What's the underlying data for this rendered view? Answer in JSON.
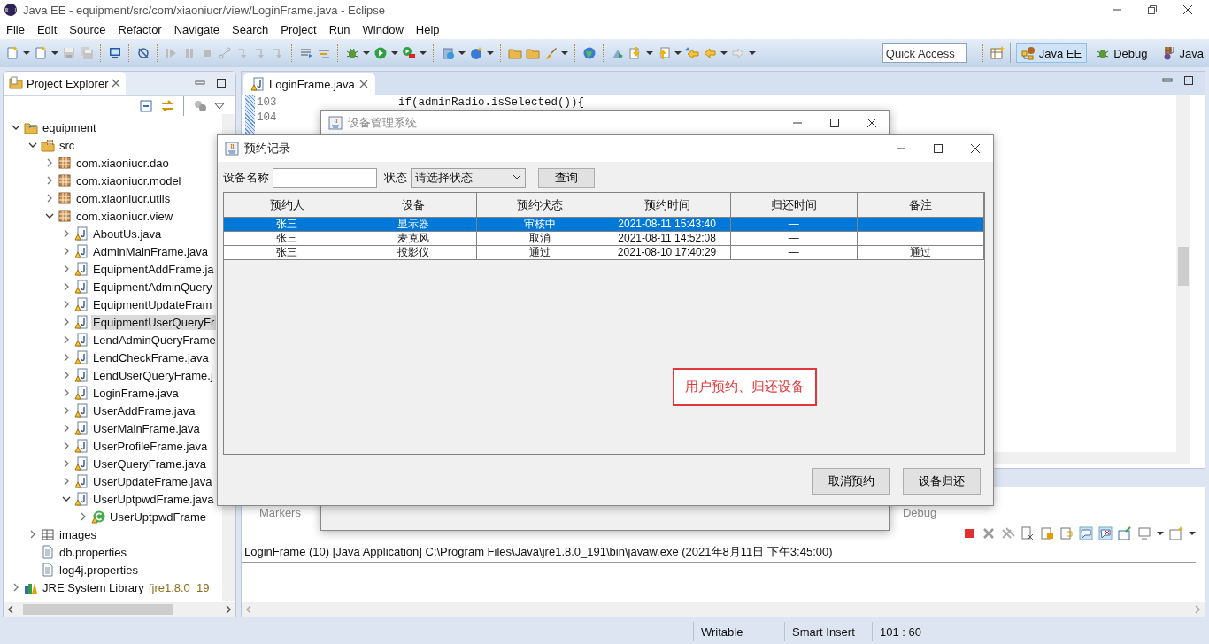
{
  "window": {
    "title": "Java EE - equipment/src/com/xiaoniucr/view/LoginFrame.java - Eclipse"
  },
  "menu": [
    "File",
    "Edit",
    "Source",
    "Refactor",
    "Navigate",
    "Search",
    "Project",
    "Run",
    "Window",
    "Help"
  ],
  "quick_access": {
    "placeholder": "Quick Access"
  },
  "perspectives": [
    {
      "label": "Java EE",
      "kind": "javaee",
      "selected": true
    },
    {
      "label": "Debug",
      "kind": "debug",
      "selected": false
    },
    {
      "label": "Java",
      "kind": "java",
      "selected": false
    }
  ],
  "project_explorer": {
    "title": "Project Explorer",
    "tree": [
      {
        "label": "equipment",
        "kind": "project",
        "expanded": true,
        "selected": false,
        "children": [
          {
            "label": "src",
            "kind": "source",
            "expanded": true,
            "selected": false,
            "children": [
              {
                "label": "com.xiaoniucr.dao",
                "kind": "package",
                "expanded": false,
                "selected": false
              },
              {
                "label": "com.xiaoniucr.model",
                "kind": "package",
                "expanded": false,
                "selected": false
              },
              {
                "label": "com.xiaoniucr.utils",
                "kind": "package",
                "expanded": false,
                "selected": false
              },
              {
                "label": "com.xiaoniucr.view",
                "kind": "package",
                "expanded": true,
                "selected": false,
                "children": [
                  {
                    "label": "AboutUs.java",
                    "kind": "java",
                    "expanded": false,
                    "selected": false
                  },
                  {
                    "label": "AdminMainFrame.java",
                    "kind": "java",
                    "expanded": false,
                    "selected": false
                  },
                  {
                    "label": "EquipmentAddFrame.ja",
                    "kind": "java",
                    "expanded": false,
                    "selected": false
                  },
                  {
                    "label": "EquipmentAdminQuery",
                    "kind": "java",
                    "expanded": false,
                    "selected": false
                  },
                  {
                    "label": "EquipmentUpdateFram",
                    "kind": "java",
                    "expanded": false,
                    "selected": false
                  },
                  {
                    "label": "EquipmentUserQueryFr",
                    "kind": "java",
                    "expanded": false,
                    "selected": true
                  },
                  {
                    "label": "LendAdminQueryFrame",
                    "kind": "java",
                    "expanded": false,
                    "selected": false
                  },
                  {
                    "label": "LendCheckFrame.java",
                    "kind": "java",
                    "expanded": false,
                    "selected": false
                  },
                  {
                    "label": "LendUserQueryFrame.j",
                    "kind": "java",
                    "expanded": false,
                    "selected": false
                  },
                  {
                    "label": "LoginFrame.java",
                    "kind": "java",
                    "expanded": false,
                    "selected": false
                  },
                  {
                    "label": "UserAddFrame.java",
                    "kind": "java",
                    "expanded": false,
                    "selected": false
                  },
                  {
                    "label": "UserMainFrame.java",
                    "kind": "java",
                    "expanded": false,
                    "selected": false
                  },
                  {
                    "label": "UserProfileFrame.java",
                    "kind": "java",
                    "expanded": false,
                    "selected": false
                  },
                  {
                    "label": "UserQueryFrame.java",
                    "kind": "java",
                    "expanded": false,
                    "selected": false
                  },
                  {
                    "label": "UserUpdateFrame.java",
                    "kind": "java",
                    "expanded": false,
                    "selected": false
                  },
                  {
                    "label": "UserUptpwdFrame.java",
                    "kind": "java",
                    "expanded": true,
                    "selected": false,
                    "children": [
                      {
                        "label": "UserUptpwdFrame",
                        "kind": "class",
                        "expanded": false,
                        "selected": false
                      }
                    ]
                  }
                ]
              }
            ]
          },
          {
            "label": "images",
            "kind": "folder",
            "expanded": false,
            "selected": false
          },
          {
            "label": "db.properties",
            "kind": "file",
            "selected": false
          },
          {
            "label": "log4j.properties",
            "kind": "file",
            "selected": false
          }
        ]
      },
      {
        "label": "JRE System Library",
        "detail": "[jre1.8.0_19",
        "kind": "library",
        "expanded": false,
        "selected": false
      }
    ]
  },
  "editor": {
    "tab": "LoginFrame.java",
    "lines": [
      {
        "number": "103",
        "code": "                if(adminRadio.isSelected()){"
      },
      {
        "number": "104"
      }
    ]
  },
  "console": {
    "tabs": [
      "Markers",
      "Debug"
    ],
    "header": "LoginFrame (10) [Java Application] C:\\Program Files\\Java\\jre1.8.0_191\\bin\\javaw.exe (2021年8月11日 下午3:45:00)"
  },
  "status_bar": [
    "Writable",
    "Smart Insert",
    "101 : 60"
  ],
  "background_window": {
    "title": "设备管理系统"
  },
  "dialog": {
    "title": "预约记录",
    "name_label": "设备名称",
    "status_label": "状态",
    "status_select": "请选择状态",
    "query_button": "查询",
    "columns": [
      "预约人",
      "设备",
      "预约状态",
      "预约时间",
      "归还时间",
      "备注"
    ],
    "rows": [
      {
        "person": "张三",
        "device": "显示器",
        "status": "审核中",
        "reserve_time": "2021-08-11 15:43:40",
        "return_time": "—",
        "selected": true
      },
      {
        "person": "张三",
        "device": "麦克风",
        "status": "取消",
        "reserve_time": "2021-08-11 14:52:08",
        "return_time": "—",
        "selected": false
      },
      {
        "person": "张三",
        "device": "投影仪",
        "status": "通过",
        "reserve_time": "2021-08-10 17:40:29",
        "return_time": "—",
        "note": "通过",
        "selected": false
      }
    ],
    "buttons": [
      "取消预约",
      "设备归还"
    ]
  },
  "annotation": "用户预约、归还设备"
}
